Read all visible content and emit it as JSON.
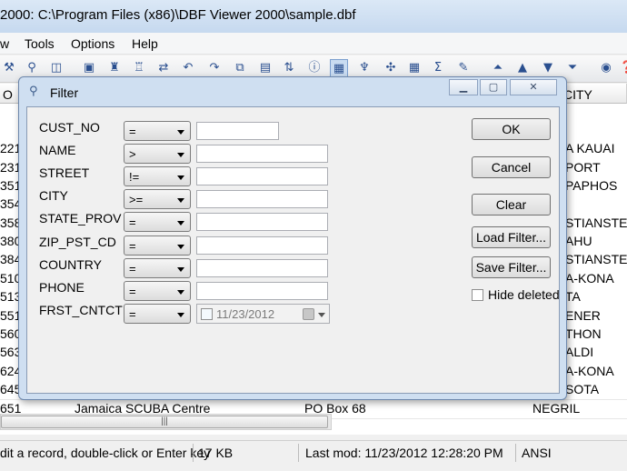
{
  "window": {
    "title": "2000: C:\\Program Files (x86)\\DBF Viewer 2000\\sample.dbf"
  },
  "menu": {
    "items": [
      "w",
      "Tools",
      "Options",
      "Help"
    ]
  },
  "toolbar": {
    "icons": [
      "tool-icon",
      "search-icon",
      "window-icon",
      "binoculars-icon",
      "find-icon",
      "replace-icon",
      "undo-icon",
      "redo-icon",
      "copy-icon",
      "paste-icon",
      "sort-icon",
      "info-icon",
      "filter-icon",
      "index-icon",
      "tools-icon",
      "grid-icon",
      "sum-icon",
      "clear-icon",
      "first-icon",
      "prev-icon",
      "next-icon",
      "last-icon",
      "globe-icon"
    ]
  },
  "grid": {
    "headers": {
      "left": "O",
      "right": "CITY"
    },
    "rows": [
      {
        "num": "221",
        "city": "A KAUAI"
      },
      {
        "num": "231",
        "city": "PORT"
      },
      {
        "num": "351",
        "city": "PAPHOS"
      },
      {
        "num": "354",
        "city": ""
      },
      {
        "num": "358",
        "city": "STIANSTED"
      },
      {
        "num": "380",
        "city": "AHU"
      },
      {
        "num": "384",
        "city": "STIANSTED"
      },
      {
        "num": "510",
        "city": "A-KONA"
      },
      {
        "num": "513",
        "city": "TA"
      },
      {
        "num": "551",
        "city": "ENER"
      },
      {
        "num": "560",
        "city": "THON"
      },
      {
        "num": "563",
        "city": "ALDI"
      },
      {
        "num": "624",
        "city": "A-KONA"
      },
      {
        "num": "645",
        "city": "SOTA"
      },
      {
        "num": "651",
        "name": "Jamaica SCUBA Centre",
        "street": "PO Box 68",
        "city": "NEGRIL"
      }
    ]
  },
  "statusbar": {
    "hint": "dit a record, double-click or Enter key",
    "size": "17 KB",
    "lastmod": "Last mod: 11/23/2012 12:28:20 PM",
    "encoding": "ANSI"
  },
  "dialog": {
    "title": "Filter",
    "fields": [
      {
        "label": "CUST_NO",
        "op": "="
      },
      {
        "label": "NAME",
        "op": ">"
      },
      {
        "label": "STREET",
        "op": "!="
      },
      {
        "label": "CITY",
        "op": ">="
      },
      {
        "label": "STATE_PROV",
        "op": "="
      },
      {
        "label": "ZIP_PST_CD",
        "op": "="
      },
      {
        "label": "COUNTRY",
        "op": "="
      },
      {
        "label": "PHONE",
        "op": "="
      },
      {
        "label": "FRST_CNTCT",
        "op": "="
      }
    ],
    "date_value": "11/23/2012",
    "buttons": {
      "ok": "OK",
      "cancel": "Cancel",
      "clear": "Clear",
      "load": "Load Filter...",
      "save": "Save Filter..."
    },
    "hide_deleted": "Hide deleted"
  }
}
